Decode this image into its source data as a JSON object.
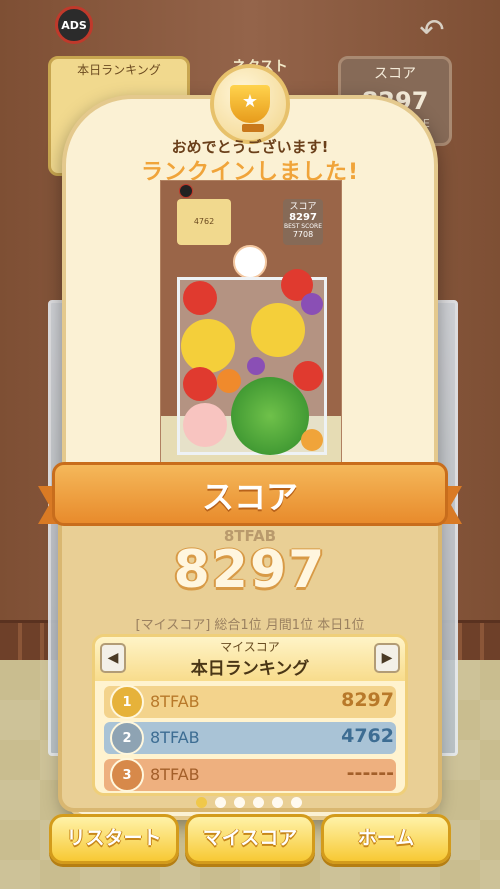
{
  "topbar": {
    "ads_label": "ADS",
    "back_icon": "undo-arrow-icon"
  },
  "background": {
    "rank_title": "本日ランキング",
    "next_label": "ネクスト",
    "score_label": "スコア",
    "score_value": "8297",
    "best_label": "BEST SCORE"
  },
  "dialog": {
    "congrats_line1": "おめでとうございます!",
    "congrats_line2": "ランクインしました!",
    "ribbon_title": "スコア",
    "player_name": "8TFAB",
    "score": "8297",
    "my_rank_line": "[マイスコア] 総合1位 月間1位 本日1位",
    "thumbnail": {
      "score_label": "スコア",
      "score_value": "8297",
      "best_label": "BEST SCORE",
      "best_value": "7708",
      "rank_value": "4762"
    }
  },
  "ranking": {
    "subtitle": "マイスコア",
    "title": "本日ランキング",
    "prev_icon": "triangle-left-icon",
    "next_icon": "triangle-right-icon",
    "rows": [
      {
        "rank": "1",
        "name": "8TFAB",
        "score": "8297",
        "color": "#f3d38c",
        "medal": "#e6b23a",
        "text": "#b8792a"
      },
      {
        "rank": "2",
        "name": "8TFAB",
        "score": "4762",
        "color": "#a9c3d6",
        "medal": "#8ea3b3",
        "text": "#3d6d93"
      },
      {
        "rank": "3",
        "name": "8TFAB",
        "score": "------",
        "color": "#eeb07f",
        "medal": "#d7894a",
        "text": "#a35f2a"
      }
    ]
  },
  "pager": {
    "pages": 6,
    "active": 0
  },
  "buttons": {
    "restart": "リスタート",
    "my_score": "マイスコア",
    "home": "ホーム"
  },
  "colors": {
    "accent_orange": "#f0a43a",
    "button_gold": "#f7c934",
    "panel_cream": "#fbf1d4"
  }
}
